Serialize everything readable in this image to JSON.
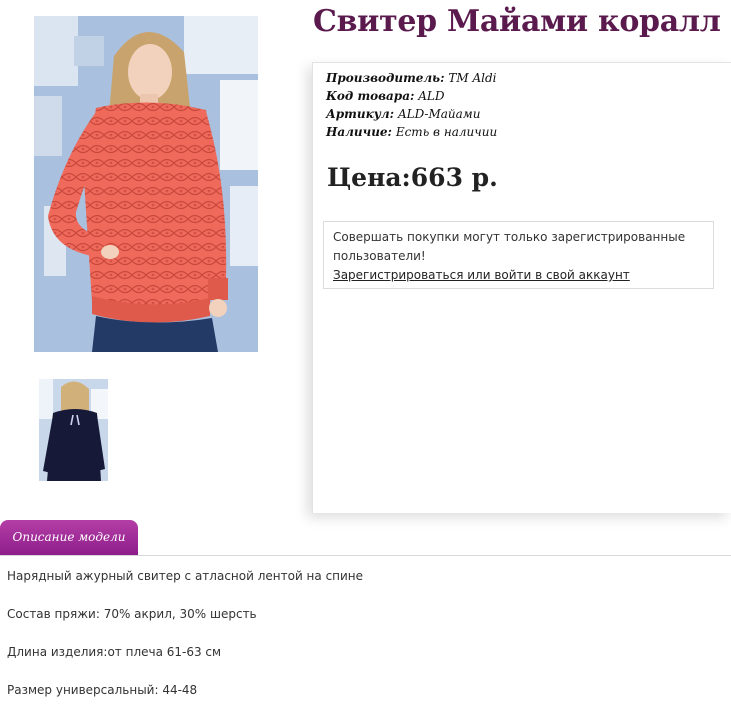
{
  "product": {
    "title": "Свитер Майами коралл",
    "images": {
      "main_alt": "main-product-photo",
      "thumbnails": [
        "back-view-photo"
      ]
    }
  },
  "info": {
    "rows": [
      {
        "label": "Производитель:",
        "value": "TM Aldi"
      },
      {
        "label": "Код товара:",
        "value": "ALD"
      },
      {
        "label": "Артикул:",
        "value": "ALD-Майами"
      },
      {
        "label": "Наличие:",
        "value": "Есть в наличии"
      }
    ],
    "price": "Цена:663 р."
  },
  "notice": {
    "text": "Совершать покупки могут только зарегистрированные пользователи!",
    "link": "Зарегистрироваться или войти в свой аккаунт"
  },
  "tabs": [
    {
      "label": "Описание модели",
      "active": true
    }
  ],
  "description": [
    "Нарядный ажурный свитер с атласной лентой на спине",
    "Состав пряжи: 70% акрил, 30% шерсть",
    "Длина изделия:от плеча 61-63 см",
    "Размер универсальный: 44-48"
  ],
  "colors": {
    "title": "#5a1a4e",
    "tab_gradient_top": "#b43ea6",
    "tab_gradient_bottom": "#8e1d8b",
    "sweater": "#ef6a5b",
    "background_wall": "#9fb8d8"
  }
}
